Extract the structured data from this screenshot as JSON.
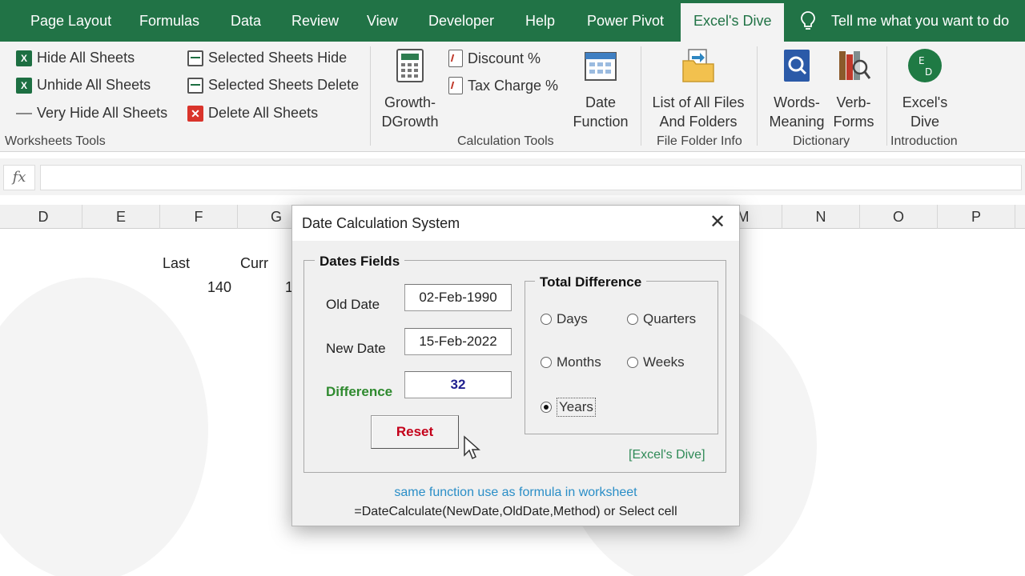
{
  "ribbon_tabs": [
    {
      "label": "Page Layout"
    },
    {
      "label": "Formulas"
    },
    {
      "label": "Data"
    },
    {
      "label": "Review"
    },
    {
      "label": "View"
    },
    {
      "label": "Developer"
    },
    {
      "label": "Help"
    },
    {
      "label": "Power Pivot"
    },
    {
      "label": "Excel's Dive",
      "active": true
    }
  ],
  "tell_me": "Tell me what you want to do",
  "ribbon": {
    "worksheets": {
      "items": [
        "Hide All Sheets",
        "Unhide All Sheets",
        "Very Hide All Sheets"
      ],
      "items2": [
        "Selected Sheets Hide",
        "Selected Sheets Delete",
        "Delete All Sheets"
      ],
      "group": "Worksheets Tools"
    },
    "calculation": {
      "growth": [
        "Growth-",
        "DGrowth"
      ],
      "discount": "Discount %",
      "tax": "Tax Charge %",
      "date_function": [
        "Date",
        "Function"
      ],
      "group": "Calculation Tools"
    },
    "file_folder": {
      "list": [
        "List of All Files",
        "And Folders"
      ],
      "group": "File Folder Info"
    },
    "dictionary": {
      "words": [
        "Words-",
        "Meaning"
      ],
      "verb": [
        "Verb-",
        "Forms"
      ],
      "group": "Dictionary"
    },
    "introduction": {
      "dive": [
        "Excel's",
        "Dive"
      ],
      "group": "Introduction"
    }
  },
  "formula_bar": {
    "fx": "fx",
    "value": ""
  },
  "columns": [
    "D",
    "E",
    "F",
    "G",
    "M",
    "N",
    "O",
    "P"
  ],
  "cells": {
    "last": "Last",
    "curr": "Curr",
    "v140": "140",
    "v1": "1"
  },
  "dialog": {
    "title": "Date Calculation System",
    "close": "✕",
    "dates_frame": "Dates Fields",
    "old_date_label": "Old Date",
    "old_date_value": "02-Feb-1990",
    "new_date_label": "New Date",
    "new_date_value": "15-Feb-2022",
    "difference_label": "Difference",
    "difference_value": "32",
    "reset_label": "Reset",
    "total_frame": "Total Difference",
    "options": [
      "Days",
      "Quarters",
      "Months",
      "Weeks",
      "Years"
    ],
    "selected_option": "Years",
    "brand": "[Excel's Dive]",
    "note_formula": "same function use as formula in worksheet",
    "note_syntax": "=DateCalculate(NewDate,OldDate,Method) or Select cell"
  },
  "colors": {
    "ribbon_green": "#217346",
    "difference_green": "#2f8a2f",
    "reset_red": "#c4001a",
    "note_blue": "#2a8ec7"
  }
}
